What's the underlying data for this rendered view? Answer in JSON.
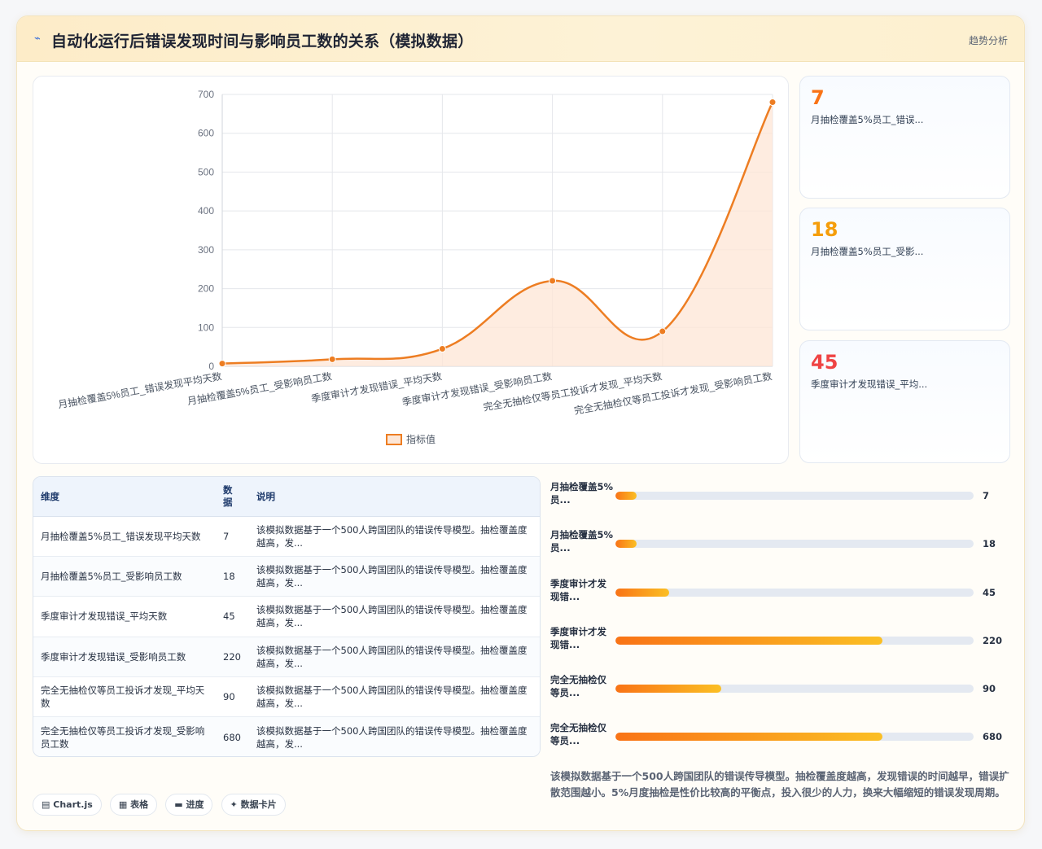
{
  "header": {
    "logo_icon": "chart-line-icon",
    "title": "自动化运行后错误发现时间与影响员工数的关系（模拟数据）",
    "trend_label": "趋势分析"
  },
  "chart_data": {
    "type": "line",
    "categories": [
      "月抽检覆盖5%员工_错误发现平均天数",
      "月抽检覆盖5%员工_受影响员工数",
      "季度审计才发现错误_平均天数",
      "季度审计才发现错误_受影响员工数",
      "完全无抽检仅等员工投诉才发现_平均天数",
      "完全无抽检仅等员工投诉才发现_受影响员工数"
    ],
    "series": [
      {
        "name": "指标值",
        "values": [
          7,
          18,
          45,
          220,
          90,
          680
        ]
      }
    ],
    "ylim": [
      0,
      700
    ],
    "yticks": [
      0,
      100,
      200,
      300,
      400,
      500,
      600,
      700
    ],
    "grid": true,
    "legend_position": "bottom",
    "colors": {
      "line": "#ed7d22",
      "fill": "#fde6d6"
    }
  },
  "stats": [
    {
      "value": "7",
      "label": "月抽检覆盖5%员工_错误...",
      "color": "#f97316"
    },
    {
      "value": "18",
      "label": "月抽检覆盖5%员工_受影...",
      "color": "#f59e0b"
    },
    {
      "value": "45",
      "label": "季度审计才发现错误_平均...",
      "color": "#ef4444"
    }
  ],
  "table": {
    "headers": [
      "维度",
      "数据",
      "说明"
    ],
    "rows": [
      {
        "dim": "月抽检覆盖5%员工_错误发现平均天数",
        "val": "7",
        "desc": "该模拟数据基于一个500人跨国团队的错误传导模型。抽检覆盖度越高，发..."
      },
      {
        "dim": "月抽检覆盖5%员工_受影响员工数",
        "val": "18",
        "desc": "该模拟数据基于一个500人跨国团队的错误传导模型。抽检覆盖度越高，发..."
      },
      {
        "dim": "季度审计才发现错误_平均天数",
        "val": "45",
        "desc": "该模拟数据基于一个500人跨国团队的错误传导模型。抽检覆盖度越高，发..."
      },
      {
        "dim": "季度审计才发现错误_受影响员工数",
        "val": "220",
        "desc": "该模拟数据基于一个500人跨国团队的错误传导模型。抽检覆盖度越高，发..."
      },
      {
        "dim": "完全无抽检仅等员工投诉才发现_平均天数",
        "val": "90",
        "desc": "该模拟数据基于一个500人跨国团队的错误传导模型。抽检覆盖度越高，发..."
      },
      {
        "dim": "完全无抽检仅等员工投诉才发现_受影响员工数",
        "val": "680",
        "desc": "该模拟数据基于一个500人跨国团队的错误传导模型。抽检覆盖度越高，发..."
      }
    ]
  },
  "progress": {
    "max": 680,
    "items": [
      {
        "label": "月抽检覆盖5%员...",
        "value": 7,
        "fraction": 0.06
      },
      {
        "label": "月抽检覆盖5%员...",
        "value": 18,
        "fraction": 0.06
      },
      {
        "label": "季度审计才发现错...",
        "value": 45,
        "fraction": 0.15
      },
      {
        "label": "季度审计才发现错...",
        "value": 220,
        "fraction": 0.745
      },
      {
        "label": "完全无抽检仅等员...",
        "value": 90,
        "fraction": 0.295
      },
      {
        "label": "完全无抽检仅等员...",
        "value": 680,
        "fraction": 0.745
      }
    ]
  },
  "note": "该模拟数据基于一个500人跨国团队的错误传导模型。抽检覆盖度越高，发现错误的时间越早，错误扩散范围越小。5%月度抽检是性价比较高的平衡点，投入很少的人力，换来大幅缩短的错误发现周期。",
  "tags": [
    {
      "icon": "chart-icon",
      "glyph": "▤",
      "label": "Chart.js"
    },
    {
      "icon": "table-icon",
      "glyph": "▦",
      "label": "表格"
    },
    {
      "icon": "progress-icon",
      "glyph": "▬",
      "label": "进度"
    },
    {
      "icon": "sparkle-icon",
      "glyph": "✦",
      "label": "数据卡片"
    }
  ]
}
